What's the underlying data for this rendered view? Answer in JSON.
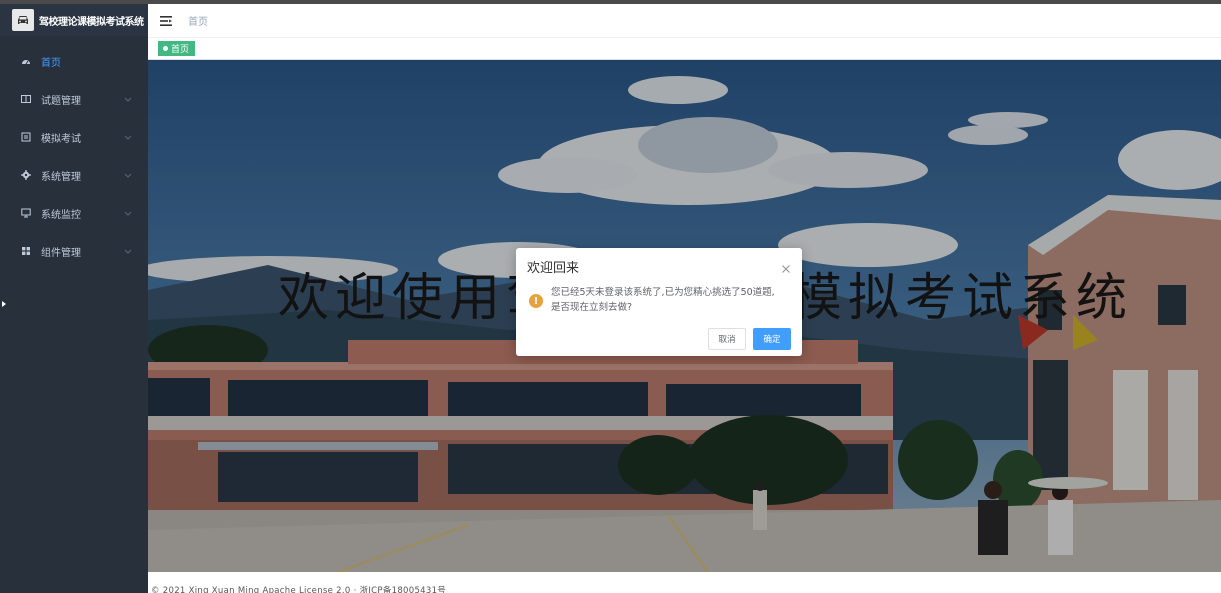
{
  "app": {
    "title": "驾校理论课模拟考试系统"
  },
  "sidebar": {
    "items": [
      {
        "label": "首页",
        "icon": "dashboard-icon",
        "active": true,
        "has_arrow": false
      },
      {
        "label": "试题管理",
        "icon": "book-icon",
        "has_arrow": true
      },
      {
        "label": "模拟考试",
        "icon": "exam-icon",
        "has_arrow": true
      },
      {
        "label": "系统管理",
        "icon": "gear-icon",
        "has_arrow": true
      },
      {
        "label": "系统监控",
        "icon": "monitor-icon",
        "has_arrow": true
      },
      {
        "label": "组件管理",
        "icon": "grid-icon",
        "has_arrow": true
      }
    ]
  },
  "header": {
    "breadcrumb": "首页"
  },
  "tags": [
    {
      "label": "首页",
      "active": true
    }
  ],
  "banner": {
    "welcome_text": "欢迎使用驾校理论课模拟考试系统"
  },
  "dialog": {
    "title": "欢迎回来",
    "message_line1": "您已经5天未登录该系统了,已为您精心挑选了50道题,",
    "message_line2": "是否现在立刻去做?",
    "cancel_label": "取消",
    "confirm_label": "确定"
  },
  "footer": {
    "text": "© 2021 Xing Xuan Ming Apache License 2.0 · 浙ICP备18005431号"
  },
  "colors": {
    "sidebar": "#28303c",
    "accent": "#409eff",
    "tag": "#42b983",
    "warning": "#e6a23c"
  }
}
